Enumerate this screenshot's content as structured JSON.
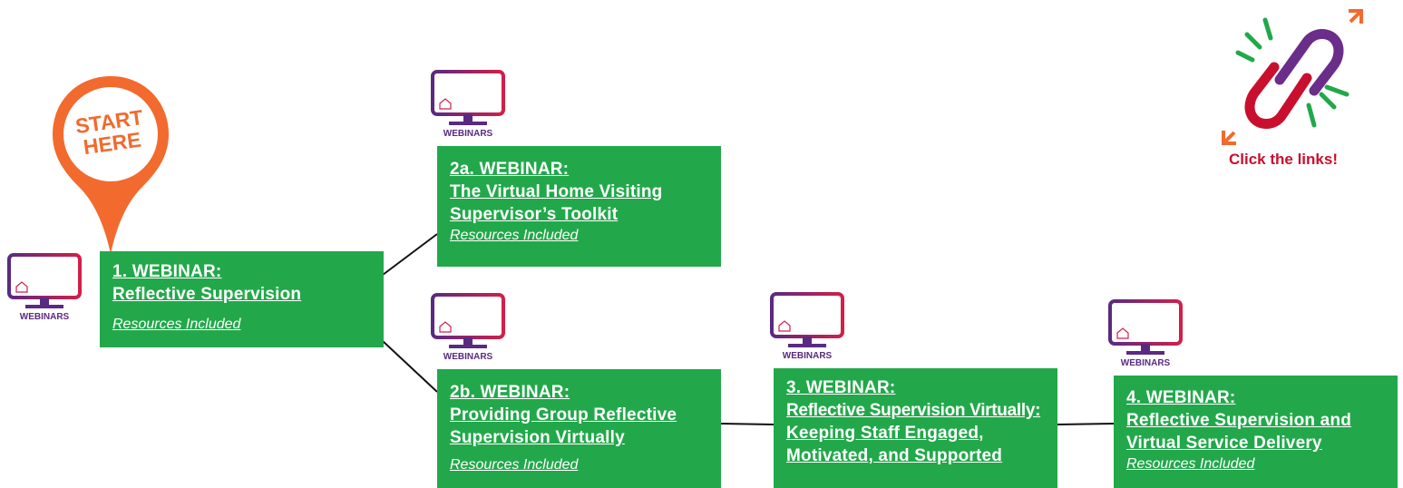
{
  "start_pin": {
    "line1": "START",
    "line2": "HERE"
  },
  "monitor_label": "WEBINARS",
  "links_hint": "Click the links!",
  "nodes": [
    {
      "id": "1",
      "label": "1. WEBINAR:",
      "lines": [
        "Reflective Supervision"
      ],
      "resources": "Resources Included"
    },
    {
      "id": "2a",
      "label": "2a. WEBINAR:",
      "lines": [
        "The Virtual Home Visiting",
        "Supervisor’s Toolkit"
      ],
      "resources": "Resources Included"
    },
    {
      "id": "2b",
      "label": "2b. WEBINAR:",
      "lines": [
        "Providing Group Reflective",
        "Supervision Virtually"
      ],
      "resources": "Resources Included"
    },
    {
      "id": "3",
      "label": "3. WEBINAR:",
      "lines": [
        "Reflective Supervision Virtually:",
        "Keeping Staff Engaged,",
        "Motivated, and Supported"
      ],
      "resources": ""
    },
    {
      "id": "4",
      "label": "4. WEBINAR:",
      "lines": [
        "Reflective Supervision and",
        "Virtual Service Delivery"
      ],
      "resources": "Resources Included"
    }
  ],
  "colors": {
    "box_green": "#22a84a",
    "pin_orange": "#f26a2e",
    "link_red": "#c8102e",
    "link_purple": "#6b2d8a",
    "spark_green": "#22a84a"
  }
}
